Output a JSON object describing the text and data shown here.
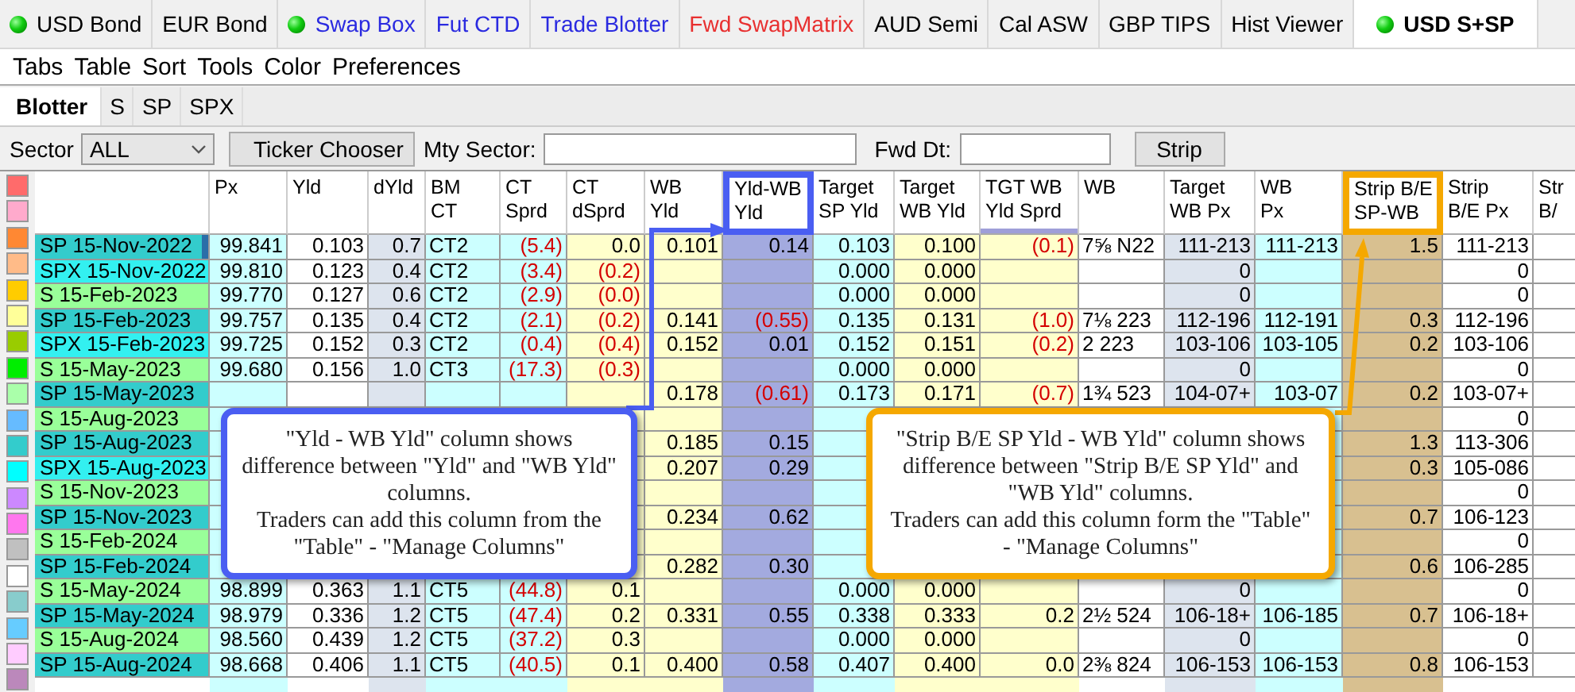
{
  "tabs": [
    {
      "label": "USD Bond",
      "status_dot": true,
      "color": "#000000",
      "selected": false
    },
    {
      "label": "EUR Bond",
      "status_dot": false,
      "color": "#000000",
      "selected": false
    },
    {
      "label": "Swap Box",
      "status_dot": true,
      "color": "#2a2ae0",
      "selected": false
    },
    {
      "label": "Fut CTD",
      "status_dot": false,
      "color": "#2a2ae0",
      "selected": false
    },
    {
      "label": "Trade Blotter",
      "status_dot": false,
      "color": "#2a2ae0",
      "selected": false
    },
    {
      "label": "Fwd SwapMatrix",
      "status_dot": false,
      "color": "#e83030",
      "selected": false
    },
    {
      "label": "AUD Semi",
      "status_dot": false,
      "color": "#000000",
      "selected": false
    },
    {
      "label": "Cal ASW",
      "status_dot": false,
      "color": "#000000",
      "selected": false
    },
    {
      "label": "GBP TIPS",
      "status_dot": false,
      "color": "#000000",
      "selected": false
    },
    {
      "label": "Hist Viewer",
      "status_dot": false,
      "color": "#000000",
      "selected": false
    },
    {
      "label": "USD S+SP",
      "status_dot": true,
      "color": "#000000",
      "selected": true
    }
  ],
  "menu": [
    "Tabs",
    "Table",
    "Sort",
    "Tools",
    "Color",
    "Preferences"
  ],
  "subtabs": [
    {
      "label": "Blotter",
      "selected": true
    },
    {
      "label": "S",
      "selected": false
    },
    {
      "label": "SP",
      "selected": false
    },
    {
      "label": "SPX",
      "selected": false
    }
  ],
  "toolbar": {
    "sector_label": "Sector",
    "sector_value": "ALL",
    "ticker_button": "Ticker Chooser",
    "mty_label": "Mty Sector:",
    "fwd_label": "Fwd Dt:",
    "strip_button": "Strip"
  },
  "swatches": [
    {
      "color": "#ff6b6b"
    },
    {
      "color": "#ffaacc"
    },
    {
      "color": "#ff8833"
    },
    {
      "color": "#ffbb88"
    },
    {
      "color": "#ffcc00"
    },
    {
      "color": "#ffff99"
    },
    {
      "color": "#99cc00"
    },
    {
      "color": "#00ee00"
    },
    {
      "color": "#aaffaa"
    },
    {
      "color": "#66bbff"
    },
    {
      "color": "#33cccc"
    },
    {
      "color": "#00ffff"
    },
    {
      "color": "#cc88ff"
    },
    {
      "color": "#ff77ee"
    },
    {
      "color": "#c0c0c0"
    },
    {
      "color": "#ffffff"
    },
    {
      "color": "#88cccc"
    },
    {
      "color": "#66ccff"
    },
    {
      "color": "#ffccff"
    },
    {
      "color": "#bb88bb"
    }
  ],
  "table": {
    "columns": [
      {
        "label": "Px",
        "sorted": false
      },
      {
        "label": "Yld",
        "sorted": false
      },
      {
        "label": "dYld",
        "sorted": false
      },
      {
        "label": "BM\nCT",
        "sorted": false
      },
      {
        "label": "CT\nSprd",
        "sorted": false
      },
      {
        "label": "CT\ndSprd",
        "sorted": false
      },
      {
        "label": "WB\nYld",
        "sorted": false
      },
      {
        "label": "Yld-WB\nYld",
        "sorted": false,
        "color": "#4a5ef2"
      },
      {
        "label": "Target\nSP Yld",
        "sorted": false
      },
      {
        "label": "Target\nWB Yld",
        "sorted": false
      },
      {
        "label": "TGT WB\nYld Sprd",
        "sorted": true
      },
      {
        "label": "WB",
        "sorted": false
      },
      {
        "label": "Target\nWB Px",
        "sorted": false
      },
      {
        "label": "WB\nPx",
        "sorted": false
      },
      {
        "label": "Strip B/E\nSP-WB",
        "sorted": false,
        "color": "#f5a800"
      },
      {
        "label": "Strip\nB/E Px",
        "sorted": false
      },
      {
        "label": "Str\nB/",
        "sorted": false
      }
    ],
    "rows": [
      {
        "name": "SP 15-Nov-2022",
        "color": "#33cccc",
        "selected": true,
        "cells": [
          "99.841",
          "0.103",
          "0.7",
          "CT2",
          "(5.4)",
          "0.0",
          "0.101",
          "0.14",
          "0.103",
          "0.100",
          "(0.1)",
          "7⅝ N22",
          "111-213",
          "111-213",
          "1.5",
          "111-213"
        ]
      },
      {
        "name": "SPX 15-Nov-2022",
        "color": "#33f0f0",
        "selected": false,
        "cells": [
          "99.810",
          "0.123",
          "0.4",
          "CT2",
          "(3.4)",
          "(0.2)",
          null,
          null,
          "0.000",
          "0.000",
          null,
          null,
          "0",
          null,
          null,
          "0"
        ]
      },
      {
        "name": "S 15-Feb-2023",
        "color": "#99ff99",
        "selected": false,
        "cells": [
          "99.770",
          "0.127",
          "0.6",
          "CT2",
          "(2.9)",
          "(0.0)",
          null,
          null,
          "0.000",
          "0.000",
          null,
          null,
          "0",
          null,
          null,
          "0"
        ]
      },
      {
        "name": "SP 15-Feb-2023",
        "color": "#33cccc",
        "selected": false,
        "cells": [
          "99.757",
          "0.135",
          "0.4",
          "CT2",
          "(2.1)",
          "(0.2)",
          "0.141",
          "(0.55)",
          "0.135",
          "0.131",
          "(1.0)",
          "7⅛ 223",
          "112-196",
          "112-191",
          "0.3",
          "112-196"
        ]
      },
      {
        "name": "SPX 15-Feb-2023",
        "color": "#33f0f0",
        "selected": false,
        "cells": [
          "99.725",
          "0.152",
          "0.3",
          "CT2",
          "(0.4)",
          "(0.4)",
          "0.152",
          "0.01",
          "0.152",
          "0.151",
          "(0.2)",
          "2 223",
          "103-106",
          "103-105",
          "0.2",
          "103-106"
        ]
      },
      {
        "name": "S 15-May-2023",
        "color": "#99ff99",
        "selected": false,
        "cells": [
          "99.680",
          "0.156",
          "1.0",
          "CT3",
          "(17.3)",
          "(0.3)",
          null,
          null,
          "0.000",
          "0.000",
          null,
          null,
          "0",
          null,
          null,
          "0"
        ]
      },
      {
        "name": "SP 15-May-2023",
        "color": "#33cccc",
        "selected": false,
        "cells": [
          null,
          null,
          null,
          null,
          null,
          null,
          "0.178",
          "(0.61)",
          "0.173",
          "0.171",
          "(0.7)",
          "1¾ 523",
          "104-07+",
          "103-07",
          "0.2",
          "103-07+"
        ]
      },
      {
        "name": "S 15-Aug-2023",
        "color": "#99ff99",
        "selected": false,
        "cells": [
          null,
          null,
          null,
          null,
          null,
          null,
          null,
          null,
          null,
          null,
          null,
          null,
          null,
          null,
          null,
          "0"
        ]
      },
      {
        "name": "SP 15-Aug-2023",
        "color": "#33cccc",
        "selected": false,
        "cells": [
          null,
          null,
          null,
          null,
          null,
          null,
          "0.185",
          "0.15",
          null,
          null,
          null,
          null,
          null,
          null,
          "1.3",
          "113-306"
        ]
      },
      {
        "name": "SPX 15-Aug-2023",
        "color": "#33f0f0",
        "selected": false,
        "cells": [
          null,
          null,
          null,
          null,
          null,
          null,
          "0.207",
          "0.29",
          null,
          null,
          null,
          null,
          null,
          null,
          "0.3",
          "105-086"
        ]
      },
      {
        "name": "S 15-Nov-2023",
        "color": "#99ff99",
        "selected": false,
        "cells": [
          null,
          null,
          null,
          null,
          null,
          null,
          null,
          null,
          null,
          null,
          null,
          null,
          null,
          null,
          null,
          "0"
        ]
      },
      {
        "name": "SP 15-Nov-2023",
        "color": "#33cccc",
        "selected": false,
        "cells": [
          null,
          null,
          null,
          null,
          null,
          null,
          "0.234",
          "0.62",
          null,
          null,
          null,
          null,
          null,
          null,
          "0.7",
          "106-123"
        ]
      },
      {
        "name": "S 15-Feb-2024",
        "color": "#99ff99",
        "selected": false,
        "cells": [
          null,
          null,
          null,
          null,
          null,
          null,
          null,
          null,
          null,
          null,
          null,
          null,
          null,
          null,
          null,
          "0"
        ]
      },
      {
        "name": "SP 15-Feb-2024",
        "color": "#33cccc",
        "selected": false,
        "cells": [
          null,
          null,
          null,
          null,
          null,
          null,
          "0.282",
          "0.30",
          null,
          null,
          null,
          null,
          null,
          null,
          "0.6",
          "106-285"
        ]
      },
      {
        "name": "S 15-May-2024",
        "color": "#99ff99",
        "selected": false,
        "cells": [
          "98.899",
          "0.363",
          "1.1",
          "CT5",
          "(44.8)",
          "0.1",
          null,
          null,
          "0.000",
          "0.000",
          null,
          null,
          "0",
          null,
          null,
          "0"
        ]
      },
      {
        "name": "SP 15-May-2024",
        "color": "#33cccc",
        "selected": false,
        "cells": [
          "98.979",
          "0.336",
          "1.2",
          "CT5",
          "(47.4)",
          "0.2",
          "0.331",
          "0.55",
          "0.338",
          "0.333",
          "0.2",
          "2½ 524",
          "106-18+",
          "106-185",
          "0.7",
          "106-18+"
        ]
      },
      {
        "name": "S 15-Aug-2024",
        "color": "#99ff99",
        "selected": false,
        "cells": [
          "98.560",
          "0.439",
          "1.2",
          "CT5",
          "(37.2)",
          "0.3",
          null,
          null,
          "0.000",
          "0.000",
          null,
          null,
          "0",
          null,
          null,
          "0"
        ]
      },
      {
        "name": "SP 15-Aug-2024",
        "color": "#33cccc",
        "selected": false,
        "cells": [
          "98.668",
          "0.406",
          "1.1",
          "CT5",
          "(40.5)",
          "0.1",
          "0.400",
          "0.58",
          "0.407",
          "0.400",
          "0.0",
          "2⅜ 824",
          "106-153",
          "106-153",
          "0.8",
          "106-153"
        ]
      }
    ]
  },
  "callouts": [
    {
      "color": "#4a5ef2",
      "paragraphs": [
        "\"Yld - WB Yld\" column shows difference between \"Yld\" and \"WB Yld\" columns.",
        "Traders can add this column from the \"Table\" - \"Manage Columns\""
      ]
    },
    {
      "color": "#f5a800",
      "paragraphs": [
        "\"Strip B/E SP Yld - WB Yld\" column shows difference between \"Strip B/E SP Yld\" and \"WB Yld\" columns.",
        "Traders can add this column form the \"Table\" - \"Manage Columns\""
      ]
    }
  ]
}
